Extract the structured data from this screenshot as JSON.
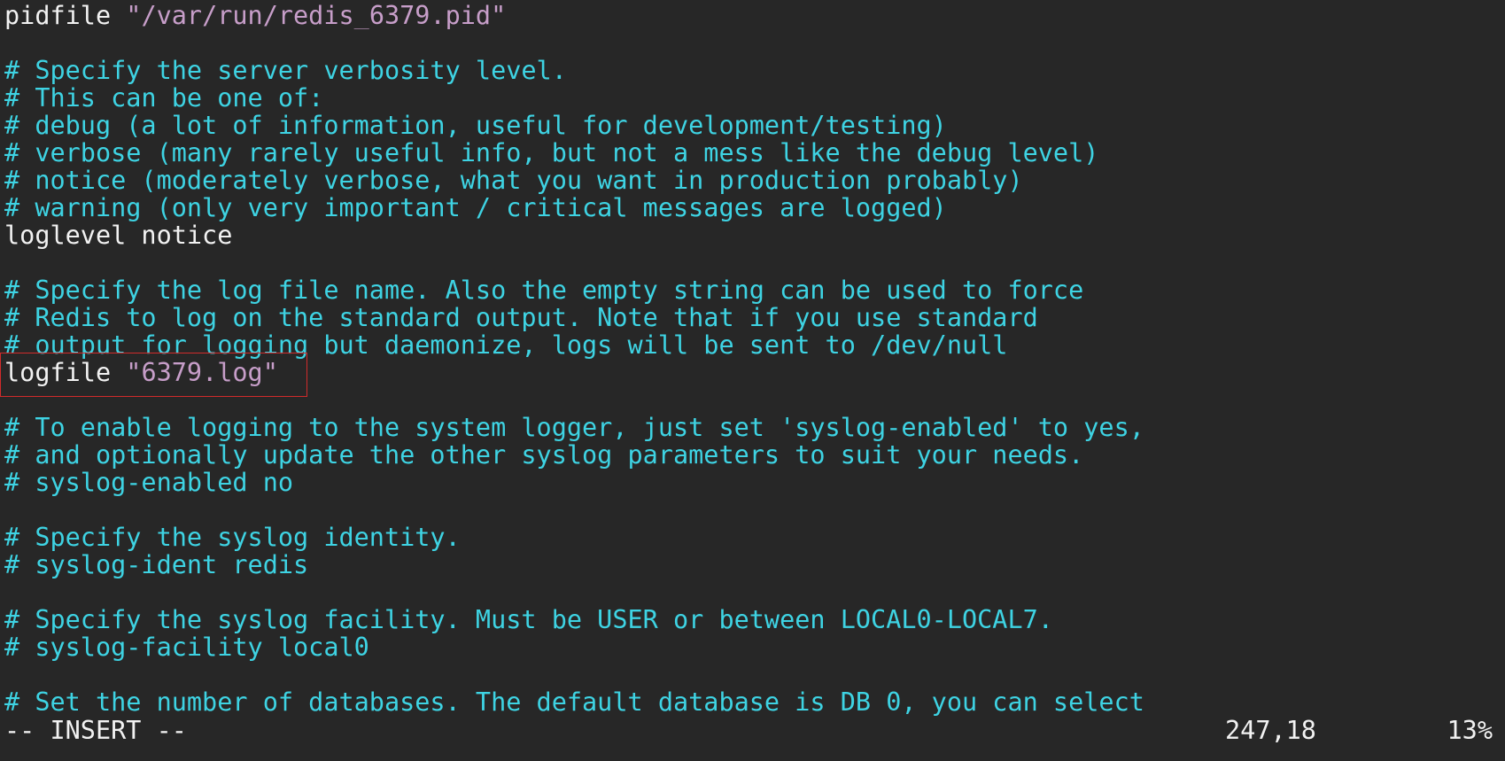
{
  "editor": {
    "lines": [
      {
        "kind": "kv",
        "key": "pidfile ",
        "value": "\"/var/run/redis_6379.pid\""
      },
      {
        "kind": "blank",
        "text": ""
      },
      {
        "kind": "comment",
        "text": "# Specify the server verbosity level."
      },
      {
        "kind": "comment",
        "text": "# This can be one of:"
      },
      {
        "kind": "comment",
        "text": "# debug (a lot of information, useful for development/testing)"
      },
      {
        "kind": "comment",
        "text": "# verbose (many rarely useful info, but not a mess like the debug level)"
      },
      {
        "kind": "comment",
        "text": "# notice (moderately verbose, what you want in production probably)"
      },
      {
        "kind": "comment",
        "text": "# warning (only very important / critical messages are logged)"
      },
      {
        "kind": "plain",
        "text": "loglevel notice"
      },
      {
        "kind": "blank",
        "text": ""
      },
      {
        "kind": "comment",
        "text": "# Specify the log file name. Also the empty string can be used to force"
      },
      {
        "kind": "comment",
        "text": "# Redis to log on the standard output. Note that if you use standard"
      },
      {
        "kind": "comment",
        "text": "# output for logging but daemonize, logs will be sent to /dev/null"
      },
      {
        "kind": "kv",
        "key": "logfile ",
        "value": "\"6379.log\""
      },
      {
        "kind": "blank",
        "text": ""
      },
      {
        "kind": "comment",
        "text": "# To enable logging to the system logger, just set 'syslog-enabled' to yes,"
      },
      {
        "kind": "comment",
        "text": "# and optionally update the other syslog parameters to suit your needs."
      },
      {
        "kind": "comment",
        "text": "# syslog-enabled no"
      },
      {
        "kind": "blank",
        "text": ""
      },
      {
        "kind": "comment",
        "text": "# Specify the syslog identity."
      },
      {
        "kind": "comment",
        "text": "# syslog-ident redis"
      },
      {
        "kind": "blank",
        "text": ""
      },
      {
        "kind": "comment",
        "text": "# Specify the syslog facility. Must be USER or between LOCAL0-LOCAL7."
      },
      {
        "kind": "comment",
        "text": "# syslog-facility local0"
      },
      {
        "kind": "blank",
        "text": ""
      },
      {
        "kind": "comment",
        "text": "# Set the number of databases. The default database is DB 0, you can select"
      }
    ]
  },
  "statusbar": {
    "mode": "-- INSERT --",
    "cursor_position": "247,18",
    "scroll_percent": "13%"
  },
  "colors": {
    "background": "#272727",
    "comment": "#3ed3e3",
    "text": "#f2f2f2",
    "string": "#c79ec9",
    "highlight_box": "#d12b2b"
  }
}
